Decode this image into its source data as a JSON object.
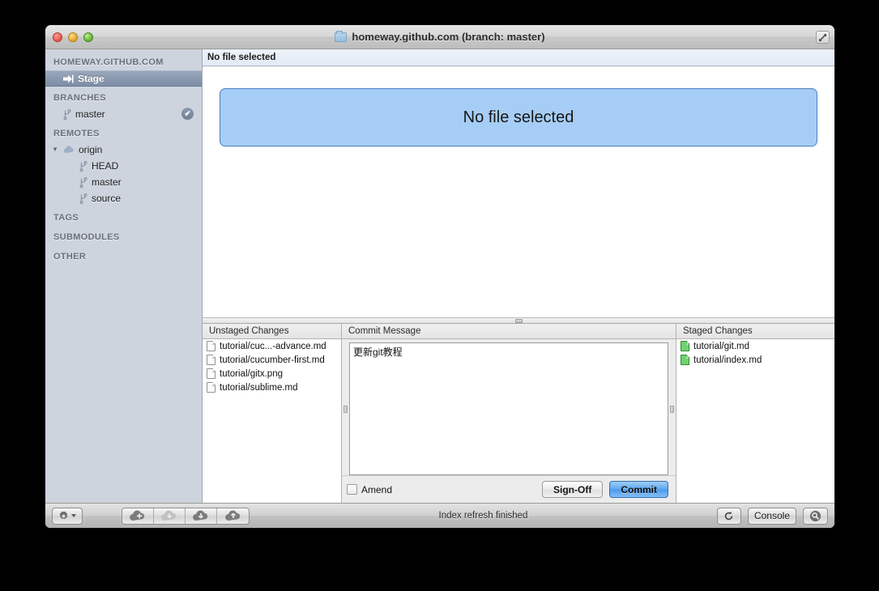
{
  "window": {
    "title": "homeway.github.com (branch: master)",
    "folder_icon": "folder-icon",
    "traffic_lights": [
      "close",
      "minimize",
      "zoom"
    ],
    "resize_icon": "fullscreen-arrows-icon"
  },
  "sidebar": {
    "repo_header": "HOMEWAY.GITHUB.COM",
    "stage": {
      "label": "Stage",
      "icon": "stage-arrow-icon",
      "selected": true
    },
    "sections": [
      {
        "header": "BRANCHES",
        "items": [
          {
            "label": "master",
            "icon": "branch-icon",
            "indent": 1,
            "badge": "✔"
          }
        ]
      },
      {
        "header": "REMOTES",
        "items": [
          {
            "label": "origin",
            "icon": "cloud-icon",
            "indent": 0,
            "disclosure": "▼"
          },
          {
            "label": "HEAD",
            "icon": "branch-icon",
            "indent": 2
          },
          {
            "label": "master",
            "icon": "branch-icon",
            "indent": 2
          },
          {
            "label": "source",
            "icon": "branch-icon",
            "indent": 2
          }
        ]
      },
      {
        "header": "TAGS",
        "items": []
      },
      {
        "header": "SUBMODULES",
        "items": []
      },
      {
        "header": "OTHER",
        "items": []
      }
    ]
  },
  "main": {
    "file_bar_title": "No file selected",
    "empty_message": "No file selected"
  },
  "panels": {
    "unstaged": {
      "title": "Unstaged Changes",
      "files": [
        "tutorial/cuc...-advance.md",
        "tutorial/cucumber-first.md",
        "tutorial/gitx.png",
        "tutorial/sublime.md"
      ]
    },
    "commit": {
      "title": "Commit Message",
      "message": "更新git教程",
      "amend_label": "Amend",
      "amend_checked": false,
      "signoff_label": "Sign-Off",
      "commit_label": "Commit"
    },
    "staged": {
      "title": "Staged Changes",
      "files": [
        "tutorial/git.md",
        "tutorial/index.md"
      ]
    }
  },
  "statusbar": {
    "gear_icon": "gear-dropdown-icon",
    "cloud_buttons": [
      {
        "name": "add-remote",
        "icon": "cloud-plus-icon",
        "enabled": true
      },
      {
        "name": "fetch",
        "icon": "cloud-fetch-icon",
        "enabled": false
      },
      {
        "name": "pull",
        "icon": "cloud-down-icon",
        "enabled": true
      },
      {
        "name": "push",
        "icon": "cloud-up-icon",
        "enabled": true
      }
    ],
    "status_text": "Index refresh finished",
    "refresh_icon": "refresh-icon",
    "console_label": "Console",
    "search_icon": "search-icon"
  },
  "colors": {
    "sidebar_bg": "#cdd4de",
    "selection": "#7e8da5",
    "accent_blue": "#4a99ec",
    "empty_box_fill": "#a6cdf6",
    "staged_green": "#6ed36e"
  }
}
